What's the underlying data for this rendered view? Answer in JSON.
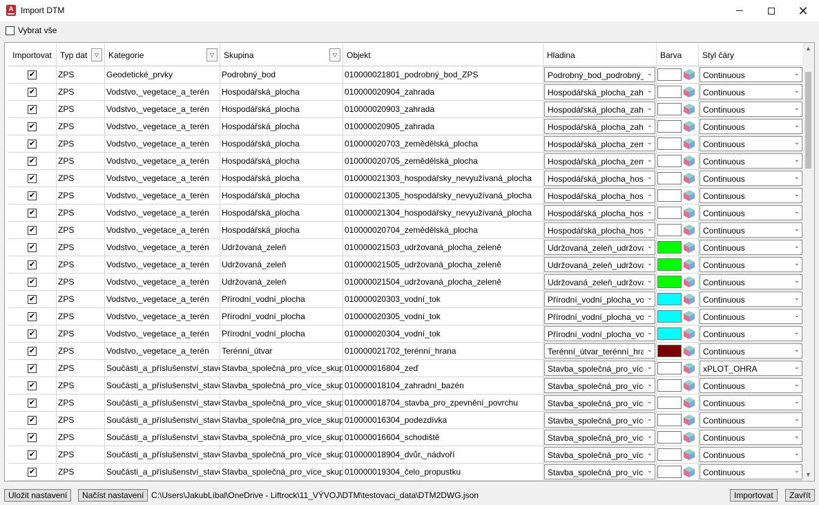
{
  "window": {
    "title": "Import DTM",
    "app_icon": "autocad-icon"
  },
  "select_all": {
    "label": "Vybrat vše",
    "checked": false
  },
  "columns": [
    "Importovat",
    "Typ dat",
    "Kategorie",
    "Skupina",
    "Objekt",
    "Hladina",
    "Barva",
    "Styl čáry"
  ],
  "rows": [
    {
      "imp": "✔",
      "typ": "ZPS",
      "kat": "Geodetické_prvky",
      "sku": "Podrobný_bod",
      "obj": "010000021801_podrobný_bod_ZPS",
      "hla": "Podrobný_bod_podrobný_",
      "bar": "#ffffff",
      "sty": "Continuous"
    },
    {
      "imp": "✔",
      "typ": "ZPS",
      "kat": "Vodstvo,_vegetace_a_terén",
      "sku": "Hospodářská_plocha",
      "obj": "010000020904_zahrada",
      "hla": "Hospodářská_plocha_zahr",
      "bar": "#ffffff",
      "sty": "Continuous"
    },
    {
      "imp": "✔",
      "typ": "ZPS",
      "kat": "Vodstvo,_vegetace_a_terén",
      "sku": "Hospodářská_plocha",
      "obj": "010000020903_zahrada",
      "hla": "Hospodářská_plocha_zahr",
      "bar": "#ffffff",
      "sty": "Continuous"
    },
    {
      "imp": "✔",
      "typ": "ZPS",
      "kat": "Vodstvo,_vegetace_a_terén",
      "sku": "Hospodářská_plocha",
      "obj": "010000020905_zahrada",
      "hla": "Hospodářská_plocha_zahr",
      "bar": "#ffffff",
      "sty": "Continuous"
    },
    {
      "imp": "✔",
      "typ": "ZPS",
      "kat": "Vodstvo,_vegetace_a_terén",
      "sku": "Hospodářská_plocha",
      "obj": "010000020703_zemědělská_plocha",
      "hla": "Hospodářská_plocha_zem",
      "bar": "#ffffff",
      "sty": "Continuous"
    },
    {
      "imp": "✔",
      "typ": "ZPS",
      "kat": "Vodstvo,_vegetace_a_terén",
      "sku": "Hospodářská_plocha",
      "obj": "010000020705_zemědělská_plocha",
      "hla": "Hospodářská_plocha_zem",
      "bar": "#ffffff",
      "sty": "Continuous"
    },
    {
      "imp": "✔",
      "typ": "ZPS",
      "kat": "Vodstvo,_vegetace_a_terén",
      "sku": "Hospodářská_plocha",
      "obj": "010000021303_hospodářsky_nevyužívaná_plocha",
      "hla": "Hospodářská_plocha_hosp",
      "bar": "#ffffff",
      "sty": "Continuous"
    },
    {
      "imp": "✔",
      "typ": "ZPS",
      "kat": "Vodstvo,_vegetace_a_terén",
      "sku": "Hospodářská_plocha",
      "obj": "010000021305_hospodářsky_nevyužívaná_plocha",
      "hla": "Hospodářská_plocha_hosp",
      "bar": "#ffffff",
      "sty": "Continuous"
    },
    {
      "imp": "✔",
      "typ": "ZPS",
      "kat": "Vodstvo,_vegetace_a_terén",
      "sku": "Hospodářská_plocha",
      "obj": "010000021304_hospodářsky_nevyužívaná_plocha",
      "hla": "Hospodářská_plocha_hosp",
      "bar": "#ffffff",
      "sty": "Continuous"
    },
    {
      "imp": "✔",
      "typ": "ZPS",
      "kat": "Vodstvo,_vegetace_a_terén",
      "sku": "Hospodářská_plocha",
      "obj": "010000020704_zemědělská_plocha",
      "hla": "Hospodářská_plocha_hosp",
      "bar": "#ffffff",
      "sty": "Continuous"
    },
    {
      "imp": "✔",
      "typ": "ZPS",
      "kat": "Vodstvo,_vegetace_a_terén",
      "sku": "Udržovaná_zeleň",
      "obj": "010000021503_udržovaná_plocha_zeleně",
      "hla": "Udržovaná_zeleň_udržova",
      "bar": "#00ff00",
      "sty": "Continuous"
    },
    {
      "imp": "✔",
      "typ": "ZPS",
      "kat": "Vodstvo,_vegetace_a_terén",
      "sku": "Udržovaná_zeleň",
      "obj": "010000021505_udržovaná_plocha_zeleně",
      "hla": "Udržovaná_zeleň_udržova",
      "bar": "#00ff00",
      "sty": "Continuous"
    },
    {
      "imp": "✔",
      "typ": "ZPS",
      "kat": "Vodstvo,_vegetace_a_terén",
      "sku": "Udržovaná_zeleň",
      "obj": "010000021504_udržovaná_plocha_zeleně",
      "hla": "Udržovaná_zeleň_udržova",
      "bar": "#00ff00",
      "sty": "Continuous"
    },
    {
      "imp": "✔",
      "typ": "ZPS",
      "kat": "Vodstvo,_vegetace_a_terén",
      "sku": "Přírodní_vodní_plocha",
      "obj": "010000020303_vodní_tok",
      "hla": "Přírodní_vodní_plocha_vo",
      "bar": "#00ffff",
      "sty": "Continuous"
    },
    {
      "imp": "✔",
      "typ": "ZPS",
      "kat": "Vodstvo,_vegetace_a_terén",
      "sku": "Přírodní_vodní_plocha",
      "obj": "010000020305_vodní_tok",
      "hla": "Přírodní_vodní_plocha_vo",
      "bar": "#00ffff",
      "sty": "Continuous"
    },
    {
      "imp": "✔",
      "typ": "ZPS",
      "kat": "Vodstvo,_vegetace_a_terén",
      "sku": "Přírodní_vodní_plocha",
      "obj": "010000020304_vodní_tok",
      "hla": "Přírodní_vodní_plocha_vo",
      "bar": "#00ffff",
      "sty": "Continuous"
    },
    {
      "imp": "✔",
      "typ": "ZPS",
      "kat": "Vodstvo,_vegetace_a_terén",
      "sku": "Terénní_útvar",
      "obj": "010000021702_terénní_hrana",
      "hla": "Terénní_útvar_terénní_hra",
      "bar": "#7a0000",
      "sty": "Continuous"
    },
    {
      "imp": "✔",
      "typ": "ZPS",
      "kat": "Součásti_a_příslušenství_staveb",
      "sku": "Stavba_společná_pro_více_skupin",
      "obj": "010000016804_zeď",
      "hla": "Stavba_společná_pro_více_",
      "bar": "#ffffff",
      "sty": "xPLOT_OHRA"
    },
    {
      "imp": "✔",
      "typ": "ZPS",
      "kat": "Součásti_a_příslušenství_staveb",
      "sku": "Stavba_společná_pro_více_skupin",
      "obj": "010000018104_zahradní_bazén",
      "hla": "Stavba_společná_pro_více_",
      "bar": "#ffffff",
      "sty": "Continuous"
    },
    {
      "imp": "✔",
      "typ": "ZPS",
      "kat": "Součásti_a_příslušenství_staveb",
      "sku": "Stavba_společná_pro_více_skupin",
      "obj": "010000018704_stavba_pro_zpevnění_povrchu",
      "hla": "Stavba_společná_pro_více_",
      "bar": "#ffffff",
      "sty": "Continuous"
    },
    {
      "imp": "✔",
      "typ": "ZPS",
      "kat": "Součásti_a_příslušenství_staveb",
      "sku": "Stavba_společná_pro_více_skupin",
      "obj": "010000016304_podezdívka",
      "hla": "Stavba_společná_pro_více_",
      "bar": "#ffffff",
      "sty": "Continuous"
    },
    {
      "imp": "✔",
      "typ": "ZPS",
      "kat": "Součásti_a_příslušenství_staveb",
      "sku": "Stavba_společná_pro_více_skupin",
      "obj": "010000016604_schodiště",
      "hla": "Stavba_společná_pro_více_",
      "bar": "#ffffff",
      "sty": "Continuous"
    },
    {
      "imp": "✔",
      "typ": "ZPS",
      "kat": "Součásti_a_příslušenství_staveb",
      "sku": "Stavba_společná_pro_více_skupin",
      "obj": "010000018904_dvůr,_nádvoří",
      "hla": "Stavba_společná_pro_více_",
      "bar": "#ffffff",
      "sty": "Continuous"
    },
    {
      "imp": "✔",
      "typ": "ZPS",
      "kat": "Součásti_a_příslušenství_staveb",
      "sku": "Stavba_společná_pro_více_skupin",
      "obj": "010000019304_čelo_propustku",
      "hla": "Stavba_společná_pro_více_",
      "bar": "#ffffff",
      "sty": "Continuous"
    }
  ],
  "footer": {
    "save_label": "Uložit nastavení",
    "load_label": "Načíst nastavení",
    "path": "C:\\Users\\JakubLíbal\\OneDrive - Liftrock\\11_VÝVOJ\\DTM\\testovaci_data\\DTM2DWG.json",
    "import_label": "Importovat",
    "close_label": "Zavřít"
  }
}
